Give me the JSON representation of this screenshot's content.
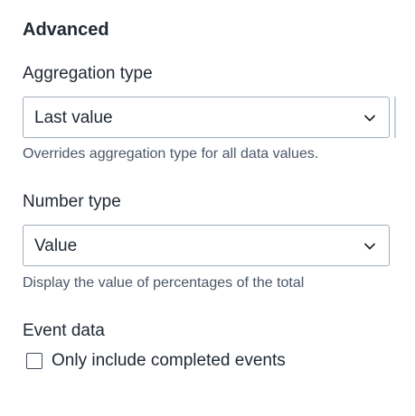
{
  "section": {
    "title": "Advanced"
  },
  "aggregation": {
    "label": "Aggregation type",
    "value": "Last value",
    "help": "Overrides aggregation type for all data values.",
    "icon": "chevron-down-icon"
  },
  "number_type": {
    "label": "Number type",
    "value": "Value",
    "help": "Display the value of percentages of the total",
    "icon": "chevron-down-icon"
  },
  "event_data": {
    "label": "Event data",
    "checkbox_label": "Only include completed events",
    "checked": false
  },
  "colors": {
    "text": "#212934",
    "help_text": "#4a5768",
    "border": "#a0adba"
  }
}
